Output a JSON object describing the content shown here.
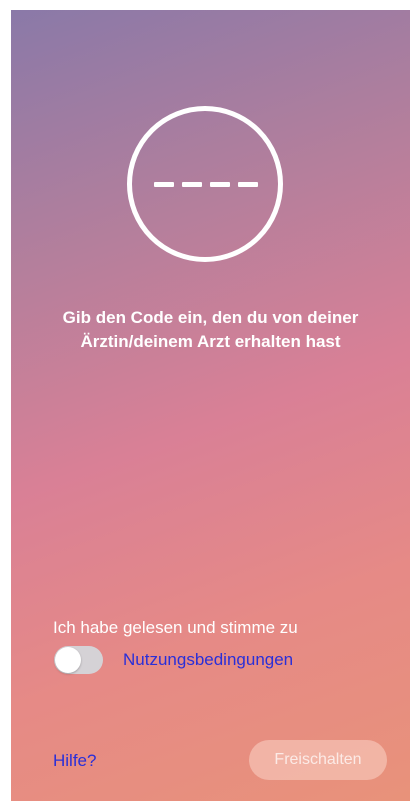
{
  "code_entry": {
    "slots": [
      "",
      "",
      "",
      ""
    ],
    "instruction": "Gib den Code ein, den du von deiner Ärztin/deinem Arzt erhalten hast"
  },
  "consent": {
    "label": "Ich habe gelesen und stimme zu",
    "toggle_on": false,
    "terms_link": "Nutzungsbedingungen"
  },
  "footer": {
    "help_link": "Hilfe?",
    "unlock_button": "Freischalten",
    "unlock_enabled": false
  },
  "colors": {
    "gradient_top": "#8a79a8",
    "gradient_mid": "#d98096",
    "gradient_bottom": "#e8927a",
    "link": "#2a2fd8"
  }
}
